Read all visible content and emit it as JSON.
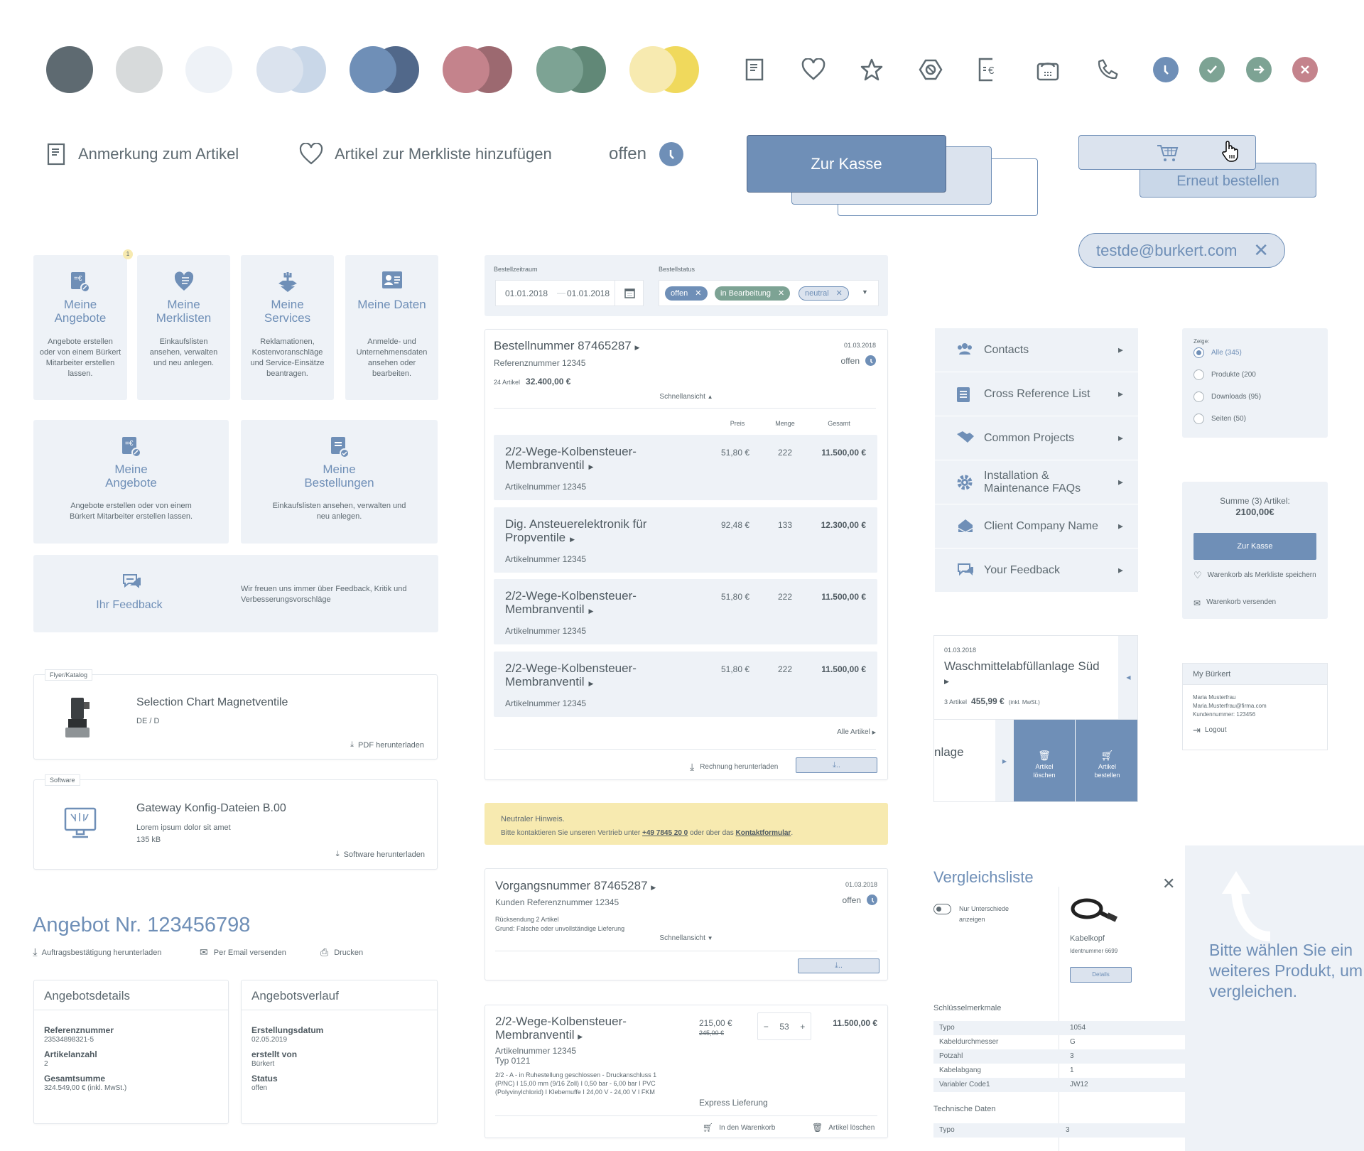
{
  "palette": {
    "swatches": [
      {
        "colors": [
          "#5e6a71"
        ]
      },
      {
        "colors": [
          "#d7dadb"
        ]
      },
      {
        "colors": [
          "#eef2f7"
        ]
      },
      {
        "colors": [
          "#dbe3ee",
          "#c9d7e8"
        ]
      },
      {
        "colors": [
          "#6f8fb7",
          "#51688a"
        ]
      },
      {
        "colors": [
          "#c4838c",
          "#9c6970"
        ]
      },
      {
        "colors": [
          "#7da394",
          "#618877"
        ]
      },
      {
        "colors": [
          "#f7eab0",
          "#f0d95c"
        ]
      }
    ]
  },
  "icons": [
    "note-icon",
    "heart-icon",
    "star-icon",
    "nut-icon",
    "invoice-euro-icon",
    "fax-icon",
    "phone-icon",
    "clock-status-icon",
    "check-status-icon",
    "arrow-status-icon",
    "close-status-icon"
  ],
  "status_colors": {
    "open": "#6f8fb7",
    "success": "#7da394",
    "error": "#c4838c"
  },
  "actions_row": {
    "note_label": "Anmerkung zum Artikel",
    "wishlist_label": "Artikel zur Merkliste hinzufügen",
    "status_label": "offen"
  },
  "buttons": {
    "checkout": "Zur Kasse",
    "reorder": "Erneut bestellen"
  },
  "email_chip": {
    "value": "testde@burkert.com"
  },
  "tiles": [
    {
      "title": "Meine Angebote",
      "desc": "Angebote erstellen oder von einem Bürkert Mitarbeiter erstellen lassen.",
      "badge": "1"
    },
    {
      "title": "Meine Merklisten",
      "desc": "Einkaufslisten ansehen, verwalten und neu anlegen."
    },
    {
      "title": "Meine Services",
      "desc": "Reklamationen, Kostenvoranschläge und Service-Einsätze beantragen."
    },
    {
      "title": "Meine Daten",
      "desc": "Anmelde- und Unternehmensdaten ansehen oder bearbeiten."
    }
  ],
  "tiles_wide": [
    {
      "title": "Meine Angebote",
      "desc": "Angebote erstellen oder von einem Bürkert Mitarbeiter erstellen lassen."
    },
    {
      "title": "Meine Bestellungen",
      "desc": "Einkaufslisten ansehen, verwalten und neu anlegen."
    }
  ],
  "feedback": {
    "title": "Ihr Feedback",
    "text": "Wir freuen uns immer über Feedback, Kritik und Verbesserungsvorschläge"
  },
  "downloads": [
    {
      "tag": "Flyer/Katalog",
      "title": "Selection Chart Magnetventile",
      "sub": "DE / D",
      "action": "PDF herunterladen"
    },
    {
      "tag": "Software",
      "title": "Gateway Konfig-Dateien B.00",
      "sub": "Lorem ipsum dolor sit amet",
      "size": "135 kB",
      "action": "Software herunterladen"
    }
  ],
  "offer": {
    "title": "Angebot Nr. 123456798",
    "actions": [
      "Auftragsbestätigung herunterladen",
      "Per Email versenden",
      "Drucken"
    ],
    "details": {
      "heading": "Angebotsdetails",
      "fields": [
        {
          "label": "Referenznummer",
          "value": "23534898321-5"
        },
        {
          "label": "Artikelanzahl",
          "value": "2"
        },
        {
          "label": "Gesamtsumme",
          "value": "324.549,00 € (inkl. MwSt.)"
        }
      ]
    },
    "history": {
      "heading": "Angebotsverlauf",
      "fields": [
        {
          "label": "Erstellungsdatum",
          "value": "02.05.2019"
        },
        {
          "label": "erstellt von",
          "value": "Bürkert"
        },
        {
          "label": "Status",
          "value": "offen"
        }
      ]
    }
  },
  "filter": {
    "period_label": "Bestellzeitraum",
    "date_from": "01.01.2018",
    "date_to": "01.01.2018",
    "status_label": "Bestellstatus",
    "chips": [
      "offen",
      "in Bearbeitung",
      "neutral"
    ]
  },
  "order": {
    "title": "Bestellnummer 87465287",
    "ref": "Referenznummer 12345",
    "date": "01.03.2018",
    "status": "offen",
    "count": "24 Artikel",
    "total": "32.400,00 €",
    "quickview": "Schnellansicht",
    "columns": [
      "Preis",
      "Menge",
      "Gesamt"
    ],
    "items": [
      {
        "name": "2/2-Wege-Kolbensteuer-Membranventil",
        "artnr": "Artikelnummer 12345",
        "price": "51,80 €",
        "qty": "222",
        "total": "11.500,00 €"
      },
      {
        "name": "Dig. Ansteuerelektronik für Propventile",
        "artnr": "Artikelnummer 12345",
        "price": "92,48 €",
        "qty": "133",
        "total": "12.300,00 €"
      },
      {
        "name": "2/2-Wege-Kolbensteuer-Membranventil",
        "artnr": "Artikelnummer 12345",
        "price": "51,80 €",
        "qty": "222",
        "total": "11.500,00 €"
      },
      {
        "name": "2/2-Wege-Kolbensteuer-Membranventil",
        "artnr": "Artikelnummer 12345",
        "price": "51,80 €",
        "qty": "222",
        "total": "11.500,00 €"
      }
    ],
    "all_items": "Alle Artikel",
    "invoice": "Rechnung herunterladen"
  },
  "notice": {
    "title": "Neutraler Hinweis.",
    "text_before": "Bitte kontaktieren Sie unseren Vertrieb unter ",
    "phone": "+49 7845 20 0",
    "text_mid": " oder über das ",
    "link": "Kontaktformular",
    "text_after": "."
  },
  "process": {
    "title": "Vorgangsnummer 87465287",
    "ref": "Kunden Referenznummer 12345",
    "date": "01.03.2018",
    "status": "offen",
    "line1": "Rücksendung 2 Artikel",
    "line2": "Grund: Falsche oder unvollständige Lieferung",
    "quickview": "Schnellansicht"
  },
  "cart_item": {
    "name": "2/2-Wege-Kolbensteuer-Membranventil",
    "artnr": "Artikelnummer 12345",
    "type": "Typ 0121",
    "desc": "2/2 - A - in Ruhestellung geschlossen - Druckanschluss 1 (P/NC) I 15,00 mm (9/16 Zoll) I 0,50 bar - 6,00 bar I PVC (Polyvinylchlorid) I Klebemuffe I 24,00 V - 24,00 V I FKM",
    "price": "215,00 €",
    "old_price": "245,00 €",
    "qty": "53",
    "total": "11.500,00 €",
    "delivery": "Express Lieferung",
    "add_to_cart": "In den Warenkorb",
    "delete": "Artikel löschen"
  },
  "menu": {
    "items": [
      "Contacts",
      "Cross Reference List",
      "Common Projects",
      "Installation & Maintenance FAQs",
      "Client Company Name",
      "Your Feedback"
    ]
  },
  "show_filter": {
    "label": "Zeige:",
    "options": [
      "Alle (345)",
      "Produkte (200",
      "Downloads (95)",
      "Seiten (50)"
    ],
    "selected": 0
  },
  "cart_summary": {
    "label": "Summe (3) Artikel:",
    "total": "2100,00€",
    "checkout": "Zur Kasse",
    "save_wishlist": "Warenkorb als Merkliste speichern",
    "send": "Warenkorb versenden"
  },
  "wishlist_card": {
    "date": "01.03.2018",
    "title": "Waschmittelabfüllanlage Süd",
    "count": "3 Artikel",
    "total": "455,99 €",
    "vat": "(inkl. MwSt.)",
    "swiped_title": "nlage",
    "delete": "Artikel löschen",
    "order": "Artikel bestellen"
  },
  "my_burkert": {
    "title": "My Bürkert",
    "name": "Maria Musterfrau",
    "email": "Maria.Musterfrau@firma.com",
    "customer": "Kundennummer: 123456",
    "logout": "Logout"
  },
  "compare": {
    "title": "Vergleichsliste",
    "toggle_label": "Nur Unterschiede anzeigen",
    "toggle_on": false,
    "product": {
      "name": "Kabelkopf",
      "id": "Identnummer 6699",
      "details": "Details"
    },
    "key_heading": "Schlüsselmerkmale",
    "key_rows": [
      {
        "label": "Typo",
        "value": "1054"
      },
      {
        "label": "Kabeldurchmesser",
        "value": "G"
      },
      {
        "label": "Potzahl",
        "value": "3"
      },
      {
        "label": "Kabelabgang",
        "value": "1"
      },
      {
        "label": "Variabler Code1",
        "value": "JW12"
      }
    ],
    "tech_heading": "Technische Daten",
    "tech_rows": [
      {
        "label": "Typo",
        "value": "3"
      }
    ],
    "hint": "Bitte wählen Sie ein weiteres Produkt, um zu vergleichen."
  }
}
